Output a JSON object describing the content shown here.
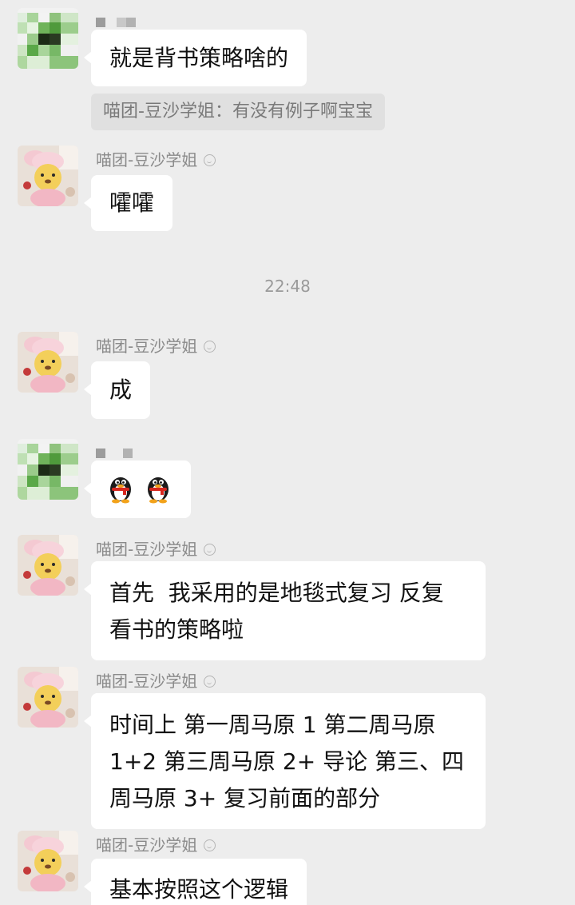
{
  "conversation": {
    "messages": [
      {
        "id": "m1",
        "sender": "",
        "text": "就是背书策略啥的"
      },
      {
        "id": "m2",
        "sender": "喵团-豆沙学姐",
        "text": "嚯嚯"
      },
      {
        "id": "m3",
        "sender": "喵团-豆沙学姐",
        "text": "成"
      },
      {
        "id": "m4",
        "sender": "",
        "emojis": [
          "penguin-emoji",
          "penguin-emoji"
        ]
      },
      {
        "id": "m5",
        "sender": "喵团-豆沙学姐",
        "lines": [
          "首先  我采用的是地毯式复习 反复",
          "看书的策略啦"
        ]
      },
      {
        "id": "m6",
        "sender": "喵团-豆沙学姐",
        "lines": [
          "时间上 第一周马原 1 第二周马原",
          "1+2 第三周马原 2+ 导论 第三、四",
          "周马原 3+ 复习前面的部分"
        ]
      },
      {
        "id": "m7",
        "sender": "喵团-豆沙学姐",
        "text": "基本按照这个逻辑"
      }
    ],
    "quote": "喵团-豆沙学姐：有没有例子啊宝宝",
    "timestamp": "22:48"
  },
  "colors": {
    "background": "#ededed",
    "bubble": "#ffffff",
    "quote_bg": "#e0e0e0",
    "name_text": "#8a8a8a"
  }
}
